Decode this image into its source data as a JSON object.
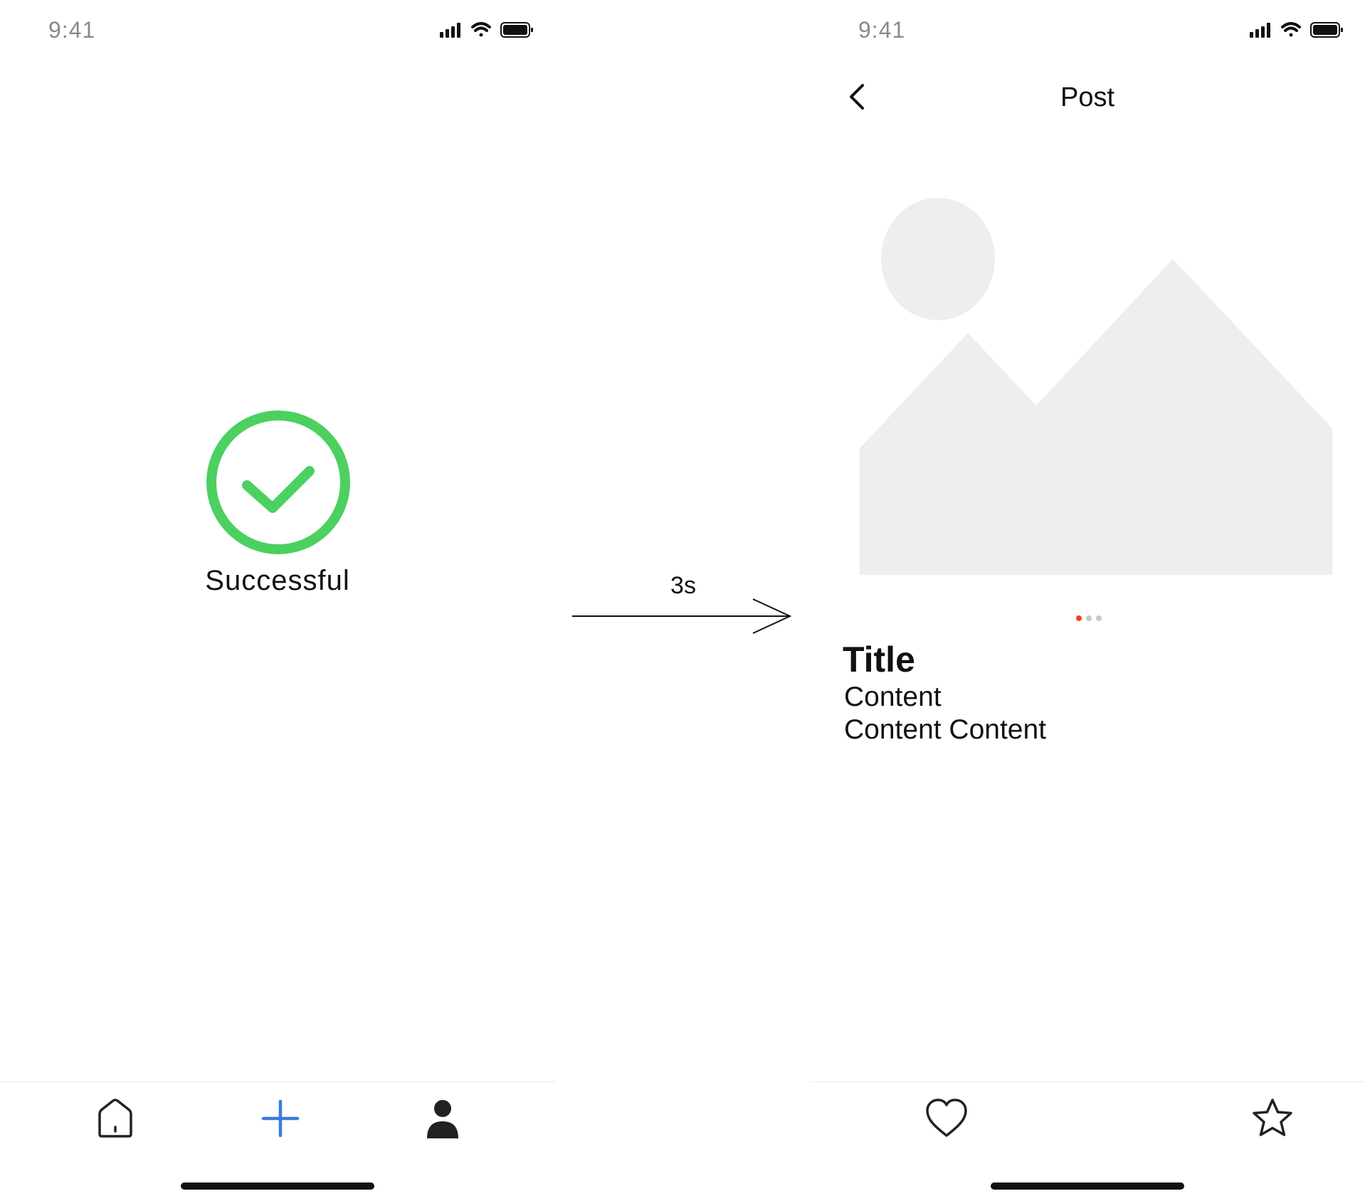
{
  "left_screen": {
    "status_bar": {
      "time": "9:41"
    },
    "success": {
      "label": "Successful",
      "color": "#4CD060"
    },
    "tab_bar": {
      "items": [
        {
          "icon": "home-icon"
        },
        {
          "icon": "plus-icon",
          "color": "#3A7BE0"
        },
        {
          "icon": "person-icon"
        }
      ]
    }
  },
  "transition": {
    "label": "3s"
  },
  "right_screen": {
    "status_bar": {
      "time": "9:41"
    },
    "nav": {
      "title": "Post",
      "back_icon": "chevron-left-icon"
    },
    "image": {
      "placeholder_icon": "image-placeholder-icon",
      "color": "#EEEEEE"
    },
    "pager": {
      "total": 3,
      "active": 1,
      "active_color": "#F0401A",
      "inactive_color": "#C8C8C8"
    },
    "post": {
      "title": "Title",
      "content_lines": [
        "Content",
        "Content Content"
      ]
    },
    "actions": [
      {
        "icon": "heart-icon"
      },
      {
        "icon": "star-icon"
      }
    ]
  }
}
